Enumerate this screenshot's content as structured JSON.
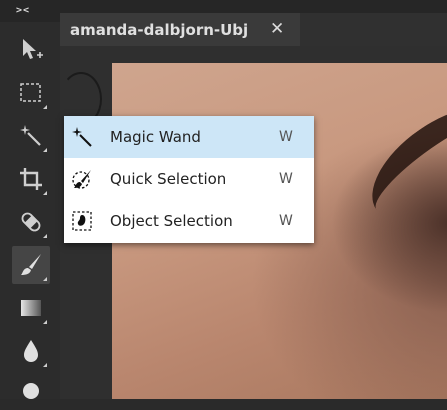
{
  "topbar": {
    "collapse_label": "><"
  },
  "document_tab": {
    "title": "amanda-dalbjorn-Ubj",
    "close_glyph": "✕"
  },
  "toolbar": {
    "tools": [
      {
        "name": "move-tool",
        "icon": "arrow-plus-icon"
      },
      {
        "name": "marquee-tool",
        "icon": "dashed-rectangle-icon"
      },
      {
        "name": "magic-wand-tool",
        "icon": "magic-wand-icon"
      },
      {
        "name": "crop-tool",
        "icon": "crop-icon"
      },
      {
        "name": "spot-healing-tool",
        "icon": "bandage-icon"
      },
      {
        "name": "brush-tool",
        "icon": "brush-icon",
        "active": true
      },
      {
        "name": "gradient-tool",
        "icon": "gradient-icon"
      },
      {
        "name": "blur-tool",
        "icon": "water-drop-icon"
      },
      {
        "name": "dodge-tool",
        "icon": "circle-icon"
      }
    ]
  },
  "flyout": {
    "items": [
      {
        "label": "Magic Wand",
        "shortcut": "W",
        "icon": "magic-wand-icon",
        "selected": true
      },
      {
        "label": "Quick Selection",
        "shortcut": "W",
        "icon": "quick-selection-brush-icon",
        "selected": false
      },
      {
        "label": "Object Selection",
        "shortcut": "W",
        "icon": "object-selection-icon",
        "selected": false
      }
    ]
  },
  "colors": {
    "toolbar_bg": "#2c2c2c",
    "tab_bg": "#3a3a3a",
    "menu_selected_bg": "#cde6f7",
    "menu_bg": "#ffffff"
  }
}
